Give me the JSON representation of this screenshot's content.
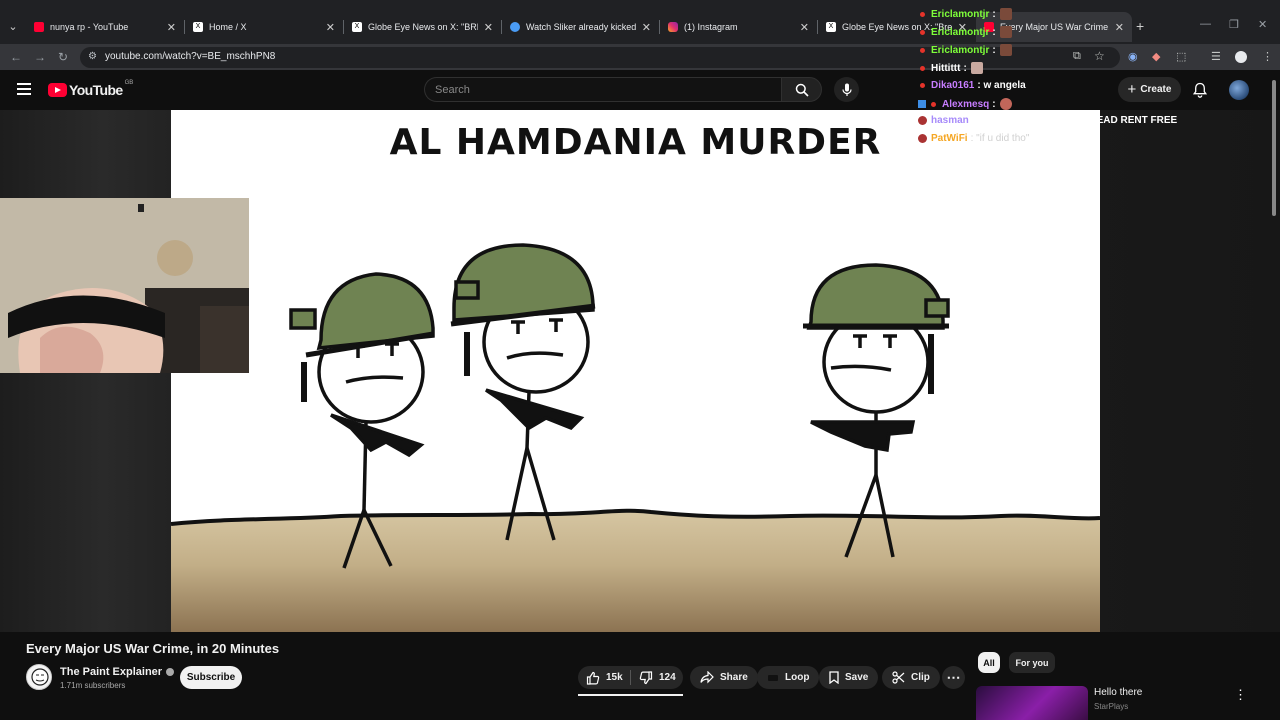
{
  "browser": {
    "tabs": [
      {
        "title": "nunya rp - YouTube",
        "favicon": "youtube-icon",
        "color": "#ff0033"
      },
      {
        "title": "Home / X",
        "favicon": "x-icon",
        "color": "#ffffff"
      },
      {
        "title": "Globe Eye News on X: \"BREAKI",
        "favicon": "x-icon",
        "color": "#ffffff"
      },
      {
        "title": "Watch Sliker already kicked out",
        "favicon": "kick-icon",
        "color": "#4a9cf5"
      },
      {
        "title": "(1) Instagram",
        "favicon": "instagram-icon",
        "color": "#e1306c"
      },
      {
        "title": "Globe Eye News on X: \"Breaki",
        "favicon": "x-icon",
        "color": "#ffffff"
      },
      {
        "title": "Every Major US War Crime, in 2",
        "favicon": "youtube-icon",
        "color": "#ff0033"
      }
    ],
    "url": "youtube.com/watch?v=BE_mschhPN8"
  },
  "youtube": {
    "logo_text": "YouTube",
    "country_code": "GB",
    "search_placeholder": "Search",
    "create_label": "Create"
  },
  "video": {
    "frame_title": "AL HAMDANIA MURDER",
    "title": "Every Major US War Crime, in 20 Minutes",
    "channel": "The Paint Explainer",
    "subscribers": "1.71m subscribers",
    "subscribe_label": "Subscribe",
    "likes": "15k",
    "dislikes": "124",
    "share_label": "Share",
    "loop_label": "Loop",
    "save_label": "Save",
    "clip_label": "Clip"
  },
  "chat": [
    {
      "user": "Ericlamontjr",
      "msg": ":",
      "color": "#7fff3a"
    },
    {
      "user": "Ericlamontjr",
      "msg": ":",
      "color": "#7fff3a"
    },
    {
      "user": "Ericlamontjr",
      "msg": ":",
      "color": "#7fff3a"
    },
    {
      "user": "Hittittt",
      "msg": ":",
      "color": "#ffffff"
    },
    {
      "user": "Dika0161",
      "msg": ": w angela",
      "color": "#c77dff"
    },
    {
      "user": "Alexmesq",
      "msg": ":",
      "color": "#c77dff"
    },
    {
      "user": "hasman",
      "msg": ": CROSSCORE IN YOUR HEAD RENT FREE",
      "color": "#a78bfa"
    },
    {
      "user": "PatWiFi",
      "msg": ": \"if u did tho\"",
      "color": "#f5a623"
    }
  ],
  "sidebar": {
    "chips": [
      "All",
      "For you"
    ],
    "rec_title": "Hello there",
    "rec_channel": "StarPlays"
  }
}
